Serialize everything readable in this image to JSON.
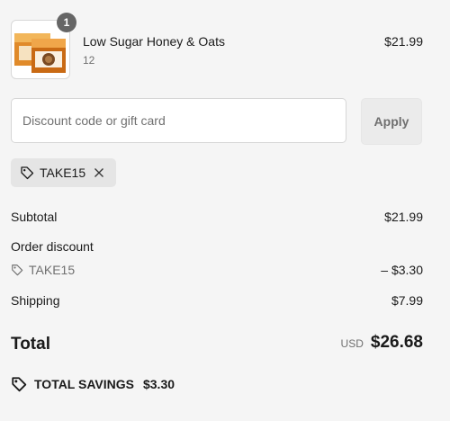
{
  "line_item": {
    "name": "Low Sugar Honey & Oats",
    "variant": "12",
    "quantity": "1",
    "price": "$21.99"
  },
  "discount": {
    "placeholder": "Discount code or gift card",
    "value": "",
    "apply_label": "Apply",
    "applied_code": "TAKE15"
  },
  "summary": {
    "subtotal_label": "Subtotal",
    "subtotal_value": "$21.99",
    "order_discount_label": "Order discount",
    "order_discount_code": "TAKE15",
    "order_discount_value": "– $3.30",
    "shipping_label": "Shipping",
    "shipping_value": "$7.99",
    "total_label": "Total",
    "currency": "USD",
    "total_value": "$26.68",
    "savings_label": "TOTAL SAVINGS",
    "savings_value": "$3.30"
  },
  "icons": {
    "tag": "tag-icon",
    "close": "close-icon"
  },
  "colors": {
    "background": "#f5f5f5",
    "muted_text": "#707070",
    "badge": "#666666"
  }
}
